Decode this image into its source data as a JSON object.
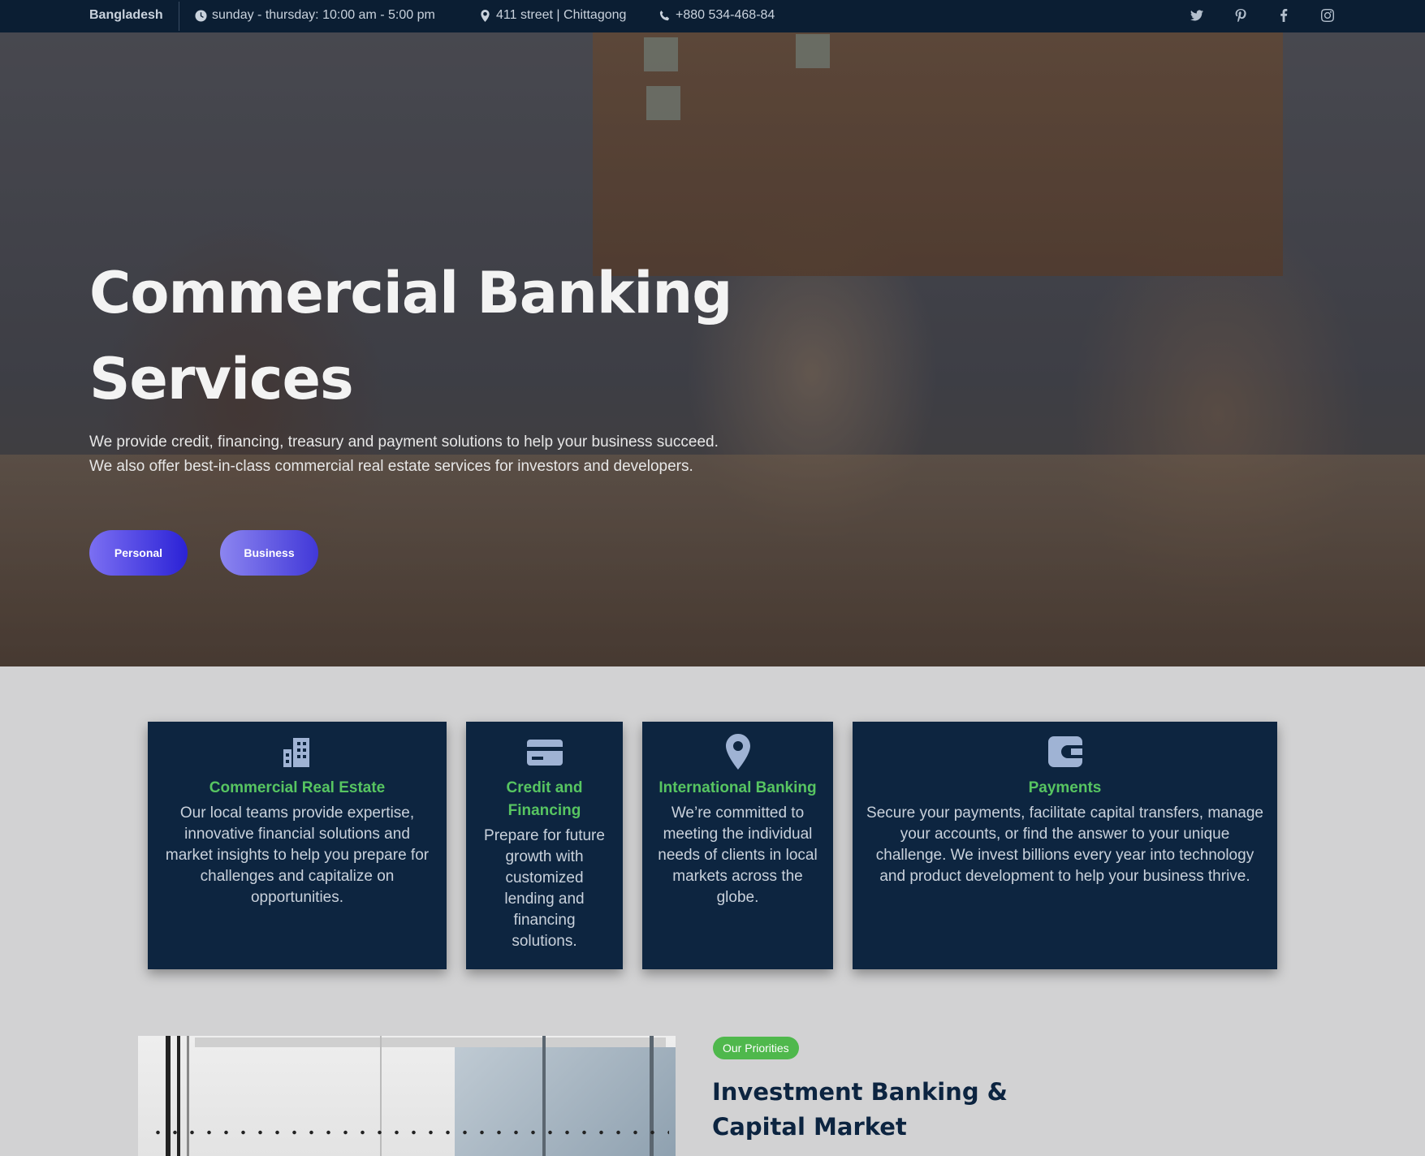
{
  "topbar": {
    "country": "Bangladesh",
    "hours": "sunday - thursday: 10:00 am - 5:00 pm",
    "address": "411 street | Chittagong",
    "phone": "+880 534-468-84",
    "social": [
      "twitter-icon",
      "pinterest-icon",
      "facebook-icon",
      "instagram-icon"
    ]
  },
  "hero": {
    "title": "Commercial Banking Services",
    "description": "We provide credit, financing, treasury and payment solutions to help your business succeed. We also offer best-in-class commercial real estate services for investors and developers.",
    "buttons": {
      "personal": "Personal",
      "business": "Business"
    }
  },
  "cards": [
    {
      "icon": "building-icon",
      "title": "Commercial Real Estate",
      "text": "Our local teams provide expertise, innovative financial solutions and market insights to help you prepare for challenges and capitalize on opportunities."
    },
    {
      "icon": "credit-card-icon",
      "title": "Credit and Financing",
      "text": "Prepare for future growth with customized lending and financing solutions."
    },
    {
      "icon": "location-pin-icon",
      "title": "International Banking",
      "text": "We’re committed to meeting the individual needs of clients in local markets across the globe."
    },
    {
      "icon": "wallet-icon",
      "title": "Payments",
      "text": "Secure your payments, facilitate capital transfers, manage your accounts, or find the answer to your unique challenge. We invest billions every year into technology and product development to help your business thrive."
    }
  ],
  "priorities": {
    "badge": "Our Priorities",
    "title": "Investment Banking & Capital Market"
  },
  "colors": {
    "topbar_bg": "#0b1e33",
    "card_bg": "#0d2540",
    "accent_green": "#57c561",
    "button_gradient": [
      "#7b6ff2",
      "#2b22d6"
    ]
  }
}
